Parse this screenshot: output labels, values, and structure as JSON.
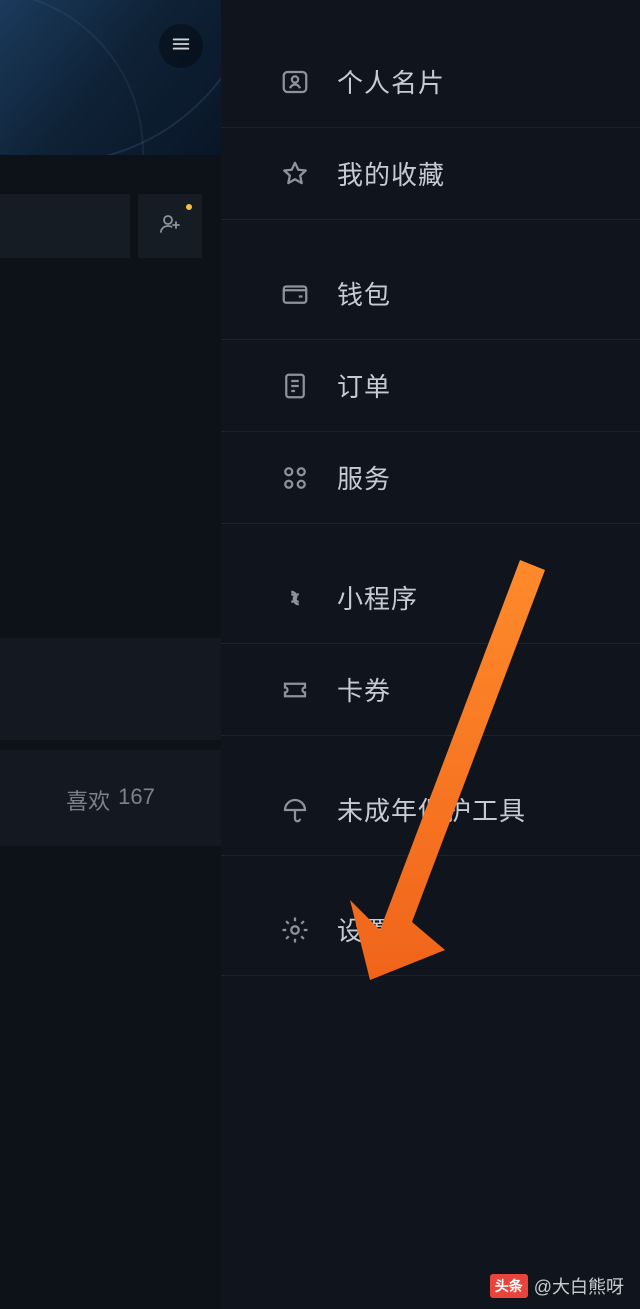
{
  "left": {
    "likes_label": "喜欢",
    "likes_count": "167"
  },
  "menu": {
    "business_card": "个人名片",
    "favorites": "我的收藏",
    "wallet": "钱包",
    "orders": "订单",
    "services": "服务",
    "mini_program": "小程序",
    "coupons": "卡券",
    "minor_protection": "未成年保护工具",
    "settings": "设置"
  },
  "watermark": {
    "prefix": "头条",
    "author": "@大白熊呀"
  }
}
